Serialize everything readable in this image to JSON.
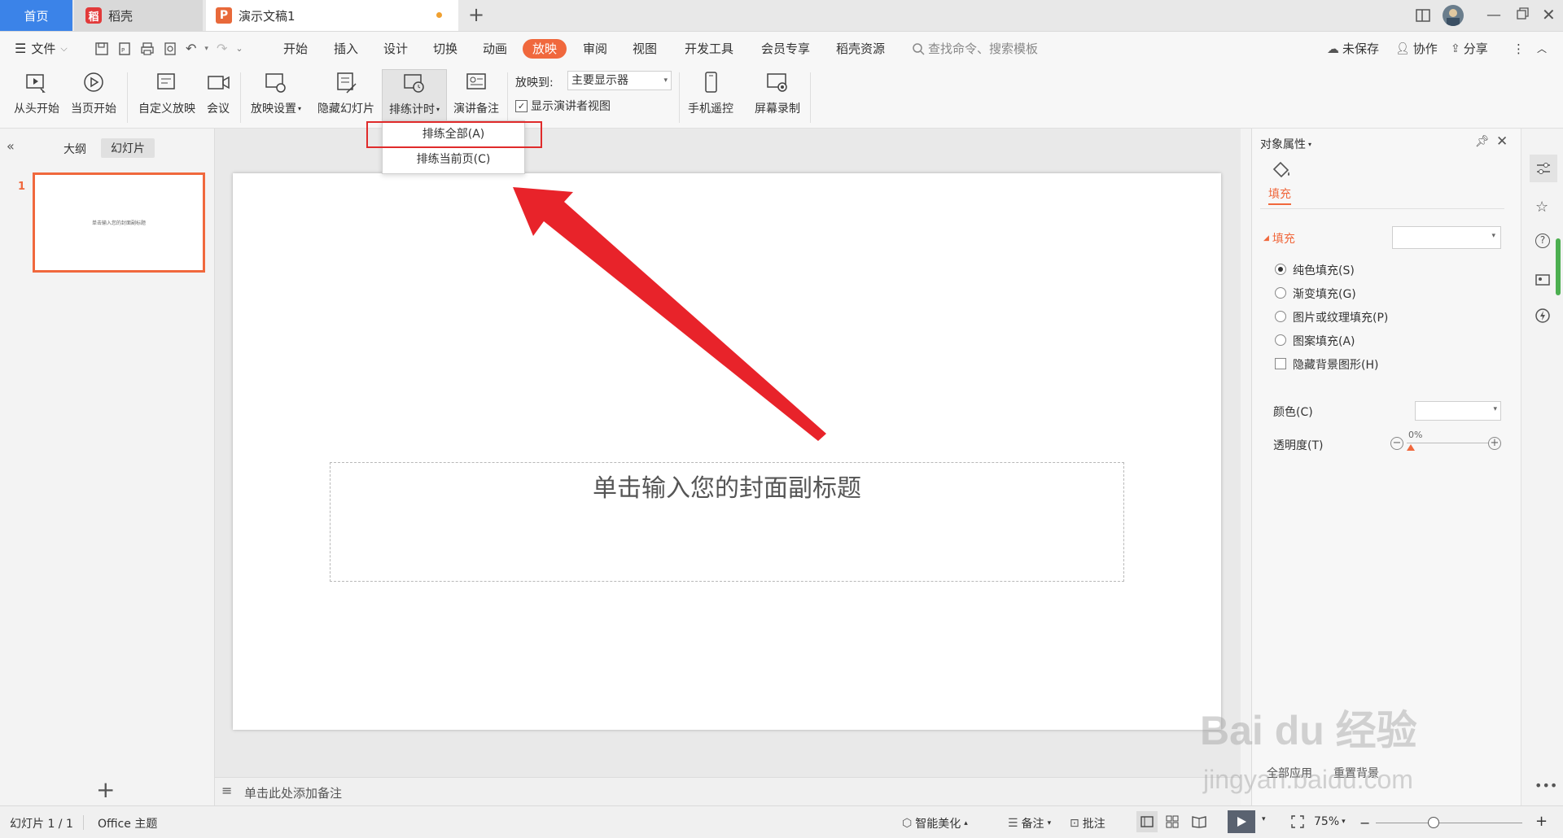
{
  "tabs": {
    "home": "首页",
    "daoke": "稻壳",
    "document": "演示文稿1",
    "new_tab": "+"
  },
  "menu": {
    "file": "文件",
    "items": [
      "开始",
      "插入",
      "设计",
      "切换",
      "动画",
      "放映",
      "审阅",
      "视图",
      "开发工具",
      "会员专享",
      "稻壳资源"
    ],
    "active": "放映",
    "search_placeholder": "查找命令、搜索模板",
    "unsaved": "未保存",
    "collaborate": "协作",
    "share": "分享"
  },
  "ribbon": {
    "from_start": "从头开始",
    "from_current": "当页开始",
    "custom_show": "自定义放映",
    "meeting": "会议",
    "show_settings": "放映设置",
    "hide_slide": "隐藏幻灯片",
    "rehearse": "排练计时",
    "speaker_notes": "演讲备注",
    "show_to_label": "放映到:",
    "show_to_value": "主要显示器",
    "presenter_view": "显示演讲者视图",
    "phone_remote": "手机遥控",
    "screen_record": "屏幕录制"
  },
  "dropdown": {
    "items": [
      "排练全部(A)",
      "排练当前页(C)"
    ]
  },
  "left_panel": {
    "tab_outline": "大纲",
    "tab_slides": "幻灯片",
    "slide_number": "1",
    "thumb_text": "单击输入您的封面副标题",
    "add": "+"
  },
  "slide": {
    "subtitle": "单击输入您的封面副标题"
  },
  "notes_placeholder": "单击此处添加备注",
  "right_panel": {
    "title": "对象属性",
    "fill_tab": "填充",
    "fill_section": "填充",
    "options": [
      "纯色填充(S)",
      "渐变填充(G)",
      "图片或纹理填充(P)",
      "图案填充(A)"
    ],
    "selected_option": "纯色填充(S)",
    "hide_bg": "隐藏背景图形(H)",
    "color_label": "颜色(C)",
    "transparency_label": "透明度(T)",
    "transparency_value": "0%",
    "apply_all": "全部应用",
    "reset_bg": "重置背景"
  },
  "status": {
    "slide_count": "幻灯片 1 / 1",
    "theme": "Office 主题",
    "beautify": "智能美化",
    "notes": "备注",
    "comments": "批注",
    "zoom": "75%"
  },
  "watermark": {
    "brand": "Bai du 经验",
    "url": "jingyan.baidu.com"
  },
  "colors": {
    "accent": "#f0683d",
    "tab_blue": "#3b83e8",
    "arrow_red": "#e8232a"
  }
}
